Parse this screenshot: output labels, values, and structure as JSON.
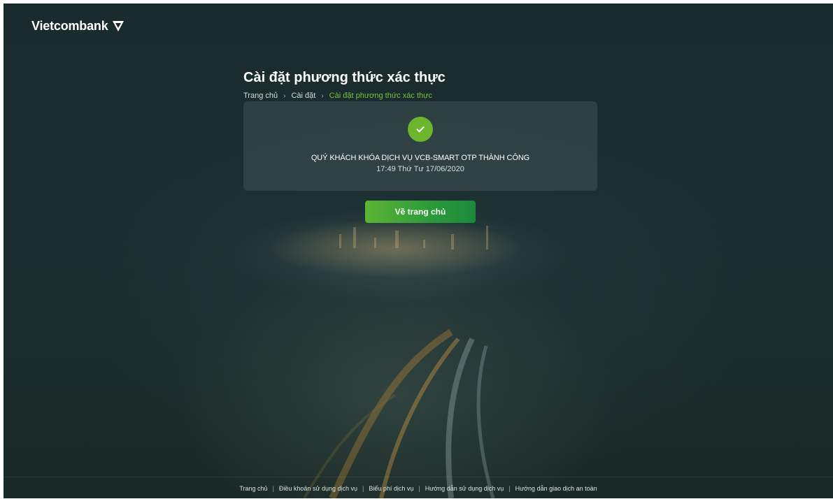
{
  "brand": {
    "name": "Vietcombank"
  },
  "page": {
    "title": "Cài đặt phương thức xác thực"
  },
  "breadcrumb": [
    {
      "label": "Trang chủ"
    },
    {
      "label": "Cài đặt"
    },
    {
      "label": "Cài đặt phương thức xác thực"
    }
  ],
  "result": {
    "message": "QUÝ KHÁCH KHÓA DỊCH VỤ VCB-SMART OTP THÀNH CÔNG",
    "timestamp": "17:49 Thứ Tư 17/06/2020",
    "icon": "check-icon",
    "status_color": "#6cb52d"
  },
  "actions": {
    "home_label": "Về trang chủ"
  },
  "footer": {
    "links": [
      {
        "label": "Trang chủ"
      },
      {
        "label": "Điều khoản sử dụng dịch vụ"
      },
      {
        "label": "Biểu phí dịch vụ"
      },
      {
        "label": "Hướng dẫn sử dụng dịch vụ"
      },
      {
        "label": "Hướng dẫn giao dịch an toàn"
      }
    ],
    "separator": "|"
  },
  "colors": {
    "background": "#18282a",
    "accent_green": "#79c142",
    "button_start": "#5cb434",
    "button_end": "#1c8a3a"
  }
}
